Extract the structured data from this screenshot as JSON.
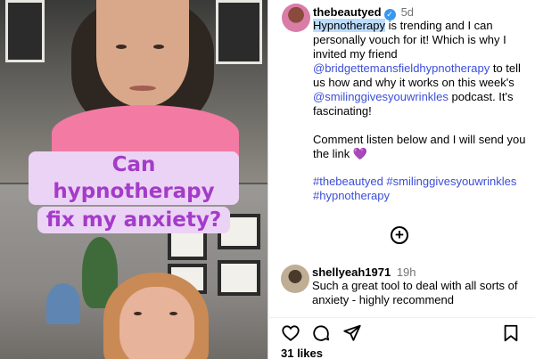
{
  "video": {
    "caption_lines": [
      "Can hypnotherapy",
      "fix my anxiety?"
    ]
  },
  "post": {
    "username": "thebeautyed",
    "time": "5d",
    "text_highlight": "Hypnotherapy",
    "text_part1": " is trending and I can personally vouch for it! Which is why I invited my friend ",
    "mention1": "@bridgettemansfieldhypnotherapy",
    "text_part2": " to tell us how and why it works on this week's ",
    "mention2": "@smilinggivesyouwrinkles",
    "text_part3": " podcast. It's fascinating!",
    "text_para2": "Comment listen below and I will send you the link",
    "emoji": "💜",
    "hashtag1": "#thebeautyed",
    "hashtag2": "#smilinggivesyouwrinkles",
    "hashtag3": "#hypnotherapy"
  },
  "comment": {
    "username": "shellyeah1971",
    "time": "19h",
    "text": "Such a great tool to deal with all sorts of anxiety - highly recommend"
  },
  "footer": {
    "likes": "31 likes"
  },
  "icons": {
    "verified": "verified-badge",
    "load_more": "plus-circle-icon",
    "like": "heart-icon",
    "comment": "comment-icon",
    "share": "send-icon",
    "save": "bookmark-icon"
  },
  "colors": {
    "caption_text": "#a43bc9",
    "caption_bg": "#ebd3f5",
    "link": "#3b4ed8",
    "verified": "#3897f0"
  }
}
